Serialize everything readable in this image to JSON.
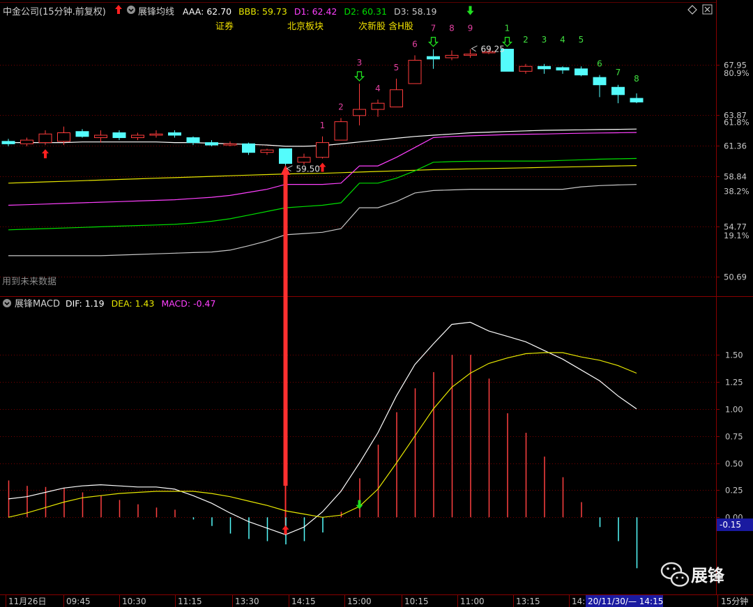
{
  "header": {
    "stock_title": "中金公司(15分钟.前复权)",
    "indicator_name": "展锋均线",
    "readouts": [
      {
        "label": "AAA: 62.70",
        "color": "#ffffff"
      },
      {
        "label": "BBB: 59.73",
        "color": "#e8e800"
      },
      {
        "label": "D1: 62.42",
        "color": "#ff40ff"
      },
      {
        "label": "D2: 60.31",
        "color": "#00e000"
      },
      {
        "label": "D3: 58.19",
        "color": "#c8c8c8"
      }
    ],
    "tags": [
      "证券",
      "北京板块",
      "次新股 含H股"
    ]
  },
  "macd_header": {
    "indicator_name": "展锋MACD",
    "readouts": [
      {
        "label": "DIF: 1.19",
        "color": "#ffffff"
      },
      {
        "label": "DEA: 1.43",
        "color": "#e8e800"
      },
      {
        "label": "MACD: -0.47",
        "color": "#ff40ff"
      }
    ]
  },
  "watermark_text": "用到未来数据",
  "logo_text": "展锋",
  "period_label": "15分钟",
  "cursor_time_label": "20/11/30/— 14:15",
  "macd_cursor_value": "-0.15",
  "colors": {
    "up": "#ff3c3c",
    "down": "#54fcfc",
    "grid": "#7a0000",
    "axis": "#8a0000"
  },
  "chart_data": [
    {
      "type": "candlestick",
      "ylim": [
        49.5,
        71.5
      ],
      "y_ticks": [
        67.95,
        63.87,
        61.36,
        58.84,
        54.77,
        50.69
      ],
      "pct_ticks": [
        {
          "value": 67.24,
          "label": "80.9%"
        },
        {
          "value": 63.24,
          "label": "61.8%"
        },
        {
          "value": 57.65,
          "label": "38.2%"
        },
        {
          "value": 54.04,
          "label": "19.1%"
        }
      ],
      "x_labels": [
        "11月26日",
        "09:45",
        "10:30",
        "11:15",
        "13:30",
        "14:15",
        "15:00",
        "10:15",
        "11:00",
        "13:15",
        "14:"
      ],
      "candles": [
        [
          61.7,
          61.5,
          61.9,
          61.3
        ],
        [
          61.5,
          61.8,
          62.0,
          61.3
        ],
        [
          61.6,
          62.3,
          62.6,
          61.4
        ],
        [
          61.7,
          62.4,
          62.9,
          61.4
        ],
        [
          62.5,
          62.1,
          62.7,
          62.0
        ],
        [
          62.0,
          62.2,
          62.6,
          61.6
        ],
        [
          62.4,
          62.0,
          62.6,
          61.8
        ],
        [
          62.0,
          62.2,
          62.4,
          61.8
        ],
        [
          62.2,
          62.3,
          62.6,
          62.0
        ],
        [
          62.4,
          62.2,
          62.6,
          62.0
        ],
        [
          62.0,
          61.6,
          62.1,
          61.4
        ],
        [
          61.6,
          61.4,
          61.8,
          61.3
        ],
        [
          61.4,
          61.5,
          61.7,
          61.3
        ],
        [
          61.5,
          60.8,
          61.6,
          60.6
        ],
        [
          60.8,
          61.0,
          61.1,
          60.6
        ],
        [
          61.1,
          59.9,
          61.1,
          59.5
        ],
        [
          60.0,
          60.4,
          60.7,
          59.8
        ],
        [
          60.4,
          61.6,
          62.1,
          60.3
        ],
        [
          61.8,
          63.3,
          63.6,
          61.8
        ],
        [
          63.8,
          64.3,
          66.4,
          63.0
        ],
        [
          64.3,
          64.8,
          65.1,
          63.7
        ],
        [
          64.5,
          65.9,
          66.8,
          64.5
        ],
        [
          66.4,
          68.3,
          68.7,
          66.4
        ],
        [
          68.6,
          68.4,
          69.2,
          67.6
        ],
        [
          68.5,
          68.7,
          69.1,
          68.3
        ],
        [
          68.7,
          68.8,
          69.2,
          68.5
        ],
        [
          68.9,
          69.0,
          69.2,
          68.8
        ],
        [
          69.2,
          67.4,
          69.2,
          67.4
        ],
        [
          67.4,
          67.8,
          68.0,
          67.2
        ],
        [
          67.8,
          67.6,
          68.0,
          67.2
        ],
        [
          67.7,
          67.5,
          67.8,
          67.2
        ],
        [
          67.6,
          67.1,
          67.8,
          67.0
        ],
        [
          66.9,
          66.3,
          67.1,
          65.3
        ],
        [
          66.1,
          65.5,
          66.3,
          64.8
        ],
        [
          65.2,
          64.9,
          65.6,
          64.8
        ]
      ],
      "markers": [
        {
          "candle": 2,
          "kind": "up-arrow"
        },
        {
          "candle": 17,
          "kind": "up-arrow"
        },
        {
          "candle": 19,
          "kind": "down-open-arrow"
        },
        {
          "candle": 23,
          "kind": "down-open-arrow"
        },
        {
          "candle": 25,
          "kind": "down-arrow"
        },
        {
          "candle": 27,
          "kind": "down-open-arrow"
        }
      ],
      "counts": [
        {
          "candle": 17,
          "label": "1",
          "color": "#e040a0"
        },
        {
          "candle": 18,
          "label": "2",
          "color": "#e040a0"
        },
        {
          "candle": 19,
          "label": "3",
          "color": "#e040a0"
        },
        {
          "candle": 20,
          "label": "4",
          "color": "#e040a0"
        },
        {
          "candle": 21,
          "label": "5",
          "color": "#e040a0"
        },
        {
          "candle": 22,
          "label": "6",
          "color": "#e040a0"
        },
        {
          "candle": 23,
          "label": "7",
          "color": "#e040a0"
        },
        {
          "candle": 24,
          "label": "8",
          "color": "#e040a0"
        },
        {
          "candle": 25,
          "label": "9",
          "color": "#e040a0"
        },
        {
          "candle": 27,
          "label": "1",
          "color": "#40e040"
        },
        {
          "candle": 28,
          "label": "2",
          "color": "#40e040"
        },
        {
          "candle": 29,
          "label": "3",
          "color": "#40e040"
        },
        {
          "candle": 30,
          "label": "4",
          "color": "#40e040"
        },
        {
          "candle": 31,
          "label": "5",
          "color": "#40e040"
        },
        {
          "candle": 32,
          "label": "6",
          "color": "#40e040"
        },
        {
          "candle": 33,
          "label": "7",
          "color": "#40e040"
        },
        {
          "candle": 34,
          "label": "8",
          "color": "#40e040"
        }
      ],
      "annotations": [
        {
          "candle": 15,
          "price": 59.5,
          "label": "59.50"
        },
        {
          "candle": 25,
          "price": 69.25,
          "label": "69.25"
        }
      ],
      "signal_bar": {
        "candle": 15,
        "from": 50.69,
        "to": 59.2
      },
      "series": [
        {
          "name": "AAA",
          "color": "#ffffff",
          "values": [
            61.6,
            61.6,
            61.6,
            61.6,
            61.65,
            61.65,
            61.65,
            61.65,
            61.65,
            61.6,
            61.6,
            61.55,
            61.5,
            61.45,
            61.4,
            61.3,
            61.3,
            61.35,
            61.5,
            61.65,
            61.8,
            61.95,
            62.1,
            62.2,
            62.3,
            62.4,
            62.45,
            62.5,
            62.55,
            62.6,
            62.62,
            62.64,
            62.66,
            62.68,
            62.7
          ]
        },
        {
          "name": "BBB",
          "color": "#e8e800",
          "values": [
            58.3,
            58.35,
            58.4,
            58.45,
            58.5,
            58.55,
            58.6,
            58.65,
            58.7,
            58.75,
            58.8,
            58.85,
            58.9,
            58.95,
            59.0,
            59.05,
            59.08,
            59.1,
            59.15,
            59.2,
            59.25,
            59.3,
            59.35,
            59.4,
            59.43,
            59.46,
            59.49,
            59.52,
            59.55,
            59.58,
            59.61,
            59.64,
            59.67,
            59.7,
            59.73
          ]
        },
        {
          "name": "D1",
          "color": "#ff40ff",
          "values": [
            56.5,
            56.55,
            56.6,
            56.65,
            56.7,
            56.75,
            56.8,
            56.85,
            56.9,
            56.95,
            57.05,
            57.15,
            57.3,
            57.55,
            57.8,
            58.2,
            58.2,
            58.2,
            58.3,
            59.7,
            59.7,
            60.4,
            61.2,
            62.0,
            62.1,
            62.15,
            62.2,
            62.25,
            62.28,
            62.3,
            62.33,
            62.36,
            62.38,
            62.4,
            62.42
          ]
        },
        {
          "name": "D2",
          "color": "#00e000",
          "values": [
            54.5,
            54.55,
            54.6,
            54.65,
            54.7,
            54.75,
            54.8,
            54.85,
            54.9,
            54.95,
            55.05,
            55.2,
            55.4,
            55.7,
            56.0,
            56.3,
            56.4,
            56.5,
            56.7,
            58.3,
            58.3,
            58.7,
            59.3,
            60.0,
            60.05,
            60.08,
            60.1,
            60.1,
            60.1,
            60.1,
            60.15,
            60.2,
            60.25,
            60.28,
            60.31
          ]
        },
        {
          "name": "D3",
          "color": "#c8c8c8",
          "values": [
            52.4,
            52.4,
            52.4,
            52.4,
            52.4,
            52.4,
            52.45,
            52.5,
            52.55,
            52.6,
            52.65,
            52.7,
            52.85,
            53.2,
            53.6,
            54.1,
            54.2,
            54.3,
            54.6,
            56.3,
            56.3,
            56.8,
            57.5,
            57.7,
            57.75,
            57.8,
            57.8,
            57.8,
            57.8,
            57.8,
            57.8,
            58.0,
            58.1,
            58.15,
            58.19
          ]
        }
      ]
    },
    {
      "type": "macd",
      "ylim": [
        -0.68,
        1.88
      ],
      "y_ticks": [
        1.5,
        1.25,
        1.0,
        0.75,
        0.5,
        0.25,
        0.0
      ],
      "series": [
        {
          "name": "DIF",
          "color": "#ffffff",
          "values": [
            0.17,
            0.19,
            0.23,
            0.27,
            0.29,
            0.3,
            0.29,
            0.28,
            0.28,
            0.26,
            0.2,
            0.13,
            0.04,
            -0.04,
            -0.1,
            -0.16,
            -0.09,
            0.05,
            0.24,
            0.5,
            0.78,
            1.12,
            1.41,
            1.6,
            1.78,
            1.8,
            1.72,
            1.67,
            1.62,
            1.54,
            1.46,
            1.36,
            1.26,
            1.12,
            1.0
          ]
        },
        {
          "name": "DEA",
          "color": "#e8e800",
          "values": [
            0.0,
            0.04,
            0.09,
            0.14,
            0.18,
            0.2,
            0.22,
            0.23,
            0.24,
            0.24,
            0.24,
            0.22,
            0.19,
            0.15,
            0.11,
            0.06,
            0.03,
            0.0,
            0.02,
            0.1,
            0.26,
            0.5,
            0.75,
            1.0,
            1.2,
            1.33,
            1.42,
            1.47,
            1.51,
            1.52,
            1.52,
            1.48,
            1.45,
            1.4,
            1.33
          ]
        },
        {
          "name": "MACD",
          "color": "#ff40ff",
          "values": [
            0.34,
            0.29,
            0.28,
            0.27,
            0.23,
            0.2,
            0.16,
            0.12,
            0.09,
            0.07,
            -0.02,
            -0.08,
            -0.15,
            -0.2,
            -0.22,
            -0.25,
            -0.22,
            -0.14,
            0.05,
            0.36,
            0.67,
            0.97,
            1.19,
            1.34,
            1.5,
            1.5,
            1.28,
            0.96,
            0.78,
            0.56,
            0.37,
            0.14,
            -0.09,
            -0.22,
            -0.47
          ]
        }
      ]
    }
  ]
}
